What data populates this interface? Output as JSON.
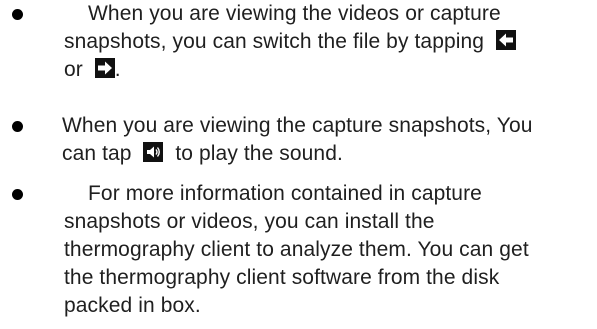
{
  "bullets": [
    {
      "lines": [
        "When you are viewing the videos or capture",
        "snapshots, you can switch the file by tapping",
        "or",
        "."
      ],
      "icons": [
        "arrow-left-icon",
        "arrow-right-icon"
      ]
    },
    {
      "lines": [
        "When you are viewing the capture snapshots, You",
        "can tap",
        "to play the sound."
      ],
      "icons": [
        "speaker-sound-icon"
      ]
    },
    {
      "lines": [
        "For more information contained in capture",
        "snapshots or videos, you can install the",
        "thermography client to analyze them. You can get",
        "the thermography client software from the disk",
        "packed in box."
      ]
    }
  ],
  "colors": {
    "text": "#1f1f1f",
    "bullet": "#000000",
    "icon_bg": "#111111",
    "icon_fg": "#ffffff"
  }
}
